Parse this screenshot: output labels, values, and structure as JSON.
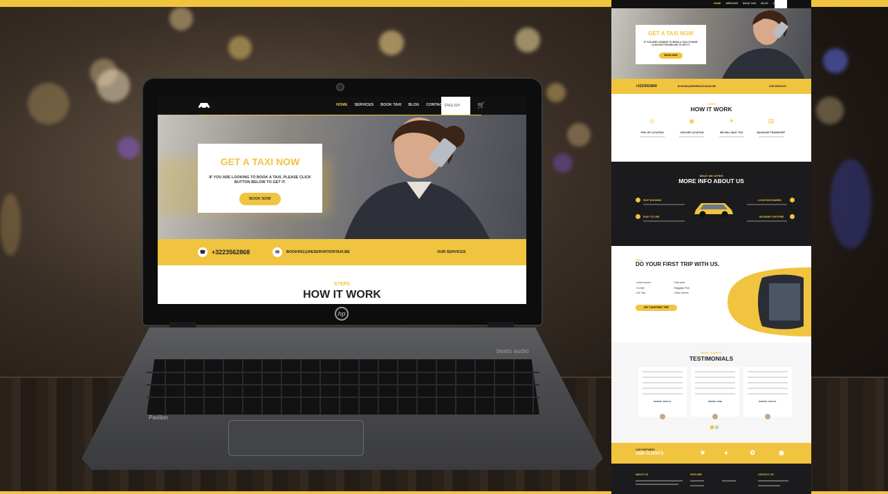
{
  "colors": {
    "accent": "#f1c43f",
    "dark": "#111111",
    "text": "#222222"
  },
  "laptop": {
    "brand": "hp",
    "model": "Pavilion",
    "audio": "beats audio"
  },
  "site": {
    "nav": {
      "logo_icon": "taxi-car-icon",
      "items": [
        "HOME",
        "SERVICES",
        "BOOK TAXI",
        "BLOG",
        "CONTACTS"
      ],
      "language": "ENGLISH",
      "cart_icon": "cart-icon"
    },
    "hero": {
      "title": "GET A TAXI NOW",
      "description": "IF YOU ARE LOOKING TO BOOK A TAXI, PLEASE CLICK BUTTON BELOW TO GET IT.",
      "button": "BOOK NOW"
    },
    "contact_bar": {
      "phone": "+3223562868",
      "email": "BOOKING@RESERVATIONTAXI.BE",
      "services": "OUR SERVICES"
    },
    "steps": {
      "label": "STEPS",
      "title": "HOW IT WORK",
      "items": [
        "PICK UP LOCATION",
        "CHOOSE LOCATION",
        "WE WILL WAIT YOU",
        "BAGGAGE TRANSPORT"
      ]
    },
    "about": {
      "label": "WHAT WE OFFER",
      "title": "MORE INFO ABOUT US",
      "features": [
        "FAST BOOKING",
        "LOCATION SHARED",
        "EASY TO USE",
        "BOOKING FOR FREE"
      ]
    },
    "trip": {
      "label": "DEAL",
      "title": "DO YOUR FIRST TRIP WITH US.",
      "list_left": [
        "Lorem Ipsum",
        "Go fast",
        "Our Taxi"
      ],
      "list_right": [
        "Fast price",
        "Baggage Pick",
        "Client drivers"
      ],
      "button": "GET YOUR FIRST TRIP"
    },
    "testimonials": {
      "label": "WHAT CLIENTS",
      "title": "TESTIMONIALS",
      "names": [
        "MANUEL PASCAL",
        "DENISE JANE",
        "MANUEL PASCAL"
      ]
    },
    "partners": {
      "label": "OUR PARTNERS",
      "title": "AND CLIENTS"
    },
    "footer": {
      "columns": [
        "ABOUT US",
        "EXPLORE",
        "CONTACT US"
      ]
    }
  }
}
